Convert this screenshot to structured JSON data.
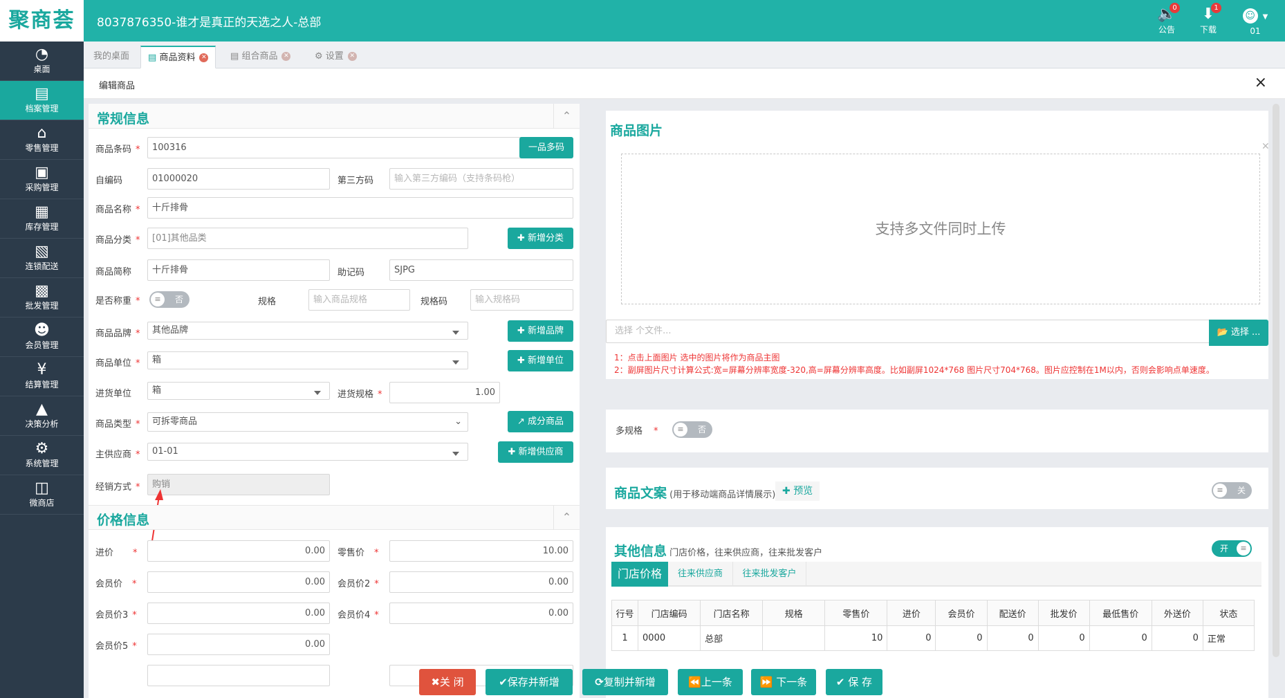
{
  "app": {
    "logo": "聚商荟",
    "title": "8037876350-谁才是真正的天选之人-总部"
  },
  "topbar": {
    "notice": {
      "label": "公告",
      "count": "0"
    },
    "download": {
      "label": "下载",
      "count": "1"
    },
    "user": {
      "label": "01"
    }
  },
  "sidebar": {
    "items": [
      {
        "label": "桌面",
        "icon": "dashboard-icon"
      },
      {
        "label": "档案管理",
        "icon": "file-icon",
        "active": true
      },
      {
        "label": "零售管理",
        "icon": "store-icon"
      },
      {
        "label": "采购管理",
        "icon": "cart-icon"
      },
      {
        "label": "库存管理",
        "icon": "inventory-icon"
      },
      {
        "label": "连锁配送",
        "icon": "truck-icon"
      },
      {
        "label": "批发管理",
        "icon": "wholesale-icon"
      },
      {
        "label": "会员管理",
        "icon": "member-icon"
      },
      {
        "label": "结算管理",
        "icon": "settlement-icon"
      },
      {
        "label": "决策分析",
        "icon": "chart-icon"
      },
      {
        "label": "系统管理",
        "icon": "gear-icon"
      },
      {
        "label": "微商店",
        "icon": "shop-bag-icon"
      }
    ]
  },
  "tabs": [
    {
      "label": "我的桌面"
    },
    {
      "label": "商品资料",
      "active": true
    },
    {
      "label": "组合商品"
    },
    {
      "label": "设置"
    }
  ],
  "page": {
    "title": "编辑商品",
    "close": "×"
  },
  "general": {
    "title": "常规信息",
    "barcode": {
      "label": "商品条码",
      "value": "100316",
      "btn": "一品多码"
    },
    "selfcode": {
      "label": "自编码",
      "value": "01000020"
    },
    "thirdcode": {
      "label": "第三方码",
      "placeholder": "输入第三方编码（支持条码枪）"
    },
    "name": {
      "label": "商品名称",
      "value": "十斤排骨"
    },
    "category": {
      "label": "商品分类",
      "value": "[01]其他品类",
      "btn": "新增分类"
    },
    "shortname": {
      "label": "商品简称",
      "value": "十斤排骨"
    },
    "mnemonic": {
      "label": "助记码",
      "value": "SJPG"
    },
    "weighing": {
      "label": "是否称重",
      "toggle": "否"
    },
    "spec": {
      "label": "规格",
      "placeholder": "输入商品规格"
    },
    "speccode": {
      "label": "规格码",
      "placeholder": "输入规格码"
    },
    "brand": {
      "label": "商品品牌",
      "value": "其他品牌",
      "btn": "新增品牌"
    },
    "unit": {
      "label": "商品单位",
      "value": "箱",
      "btn": "新增单位"
    },
    "purchase_unit": {
      "label": "进货单位",
      "value": "箱"
    },
    "purchase_spec": {
      "label": "进货规格",
      "value": "1.00"
    },
    "type": {
      "label": "商品类型",
      "value": "可拆零商品",
      "btn": "成分商品"
    },
    "supplier": {
      "label": "主供应商",
      "value": "01-01",
      "btn": "新增供应商"
    },
    "mode": {
      "label": "经销方式",
      "value": "购销"
    }
  },
  "price": {
    "title": "价格信息",
    "cost": {
      "label": "进价",
      "value": "0.00"
    },
    "retail": {
      "label": "零售价",
      "value": "10.00"
    },
    "member": {
      "label": "会员价",
      "value": "0.00"
    },
    "member2": {
      "label": "会员价2",
      "value": "0.00"
    },
    "member3": {
      "label": "会员价3",
      "value": "0.00"
    },
    "member4": {
      "label": "会员价4",
      "value": "0.00"
    },
    "member5": {
      "label": "会员价5",
      "value": "0.00"
    }
  },
  "images": {
    "title": "商品图片",
    "drop_text": "支持多文件同时上传",
    "file_placeholder": "选择 个文件...",
    "choose_btn": "选择 ...",
    "note1": "1：点击上面图片 选中的图片将作为商品主图",
    "note2": "2：副屏图片尺寸计算公式:宽=屏幕分辨率宽度-320,高=屏幕分辨率高度。比如副屏1024*768 图片尺寸704*768。图片应控制在1M以内，否则会影响点单速度。"
  },
  "multispec": {
    "label": "多规格",
    "toggle": "否"
  },
  "copy": {
    "title": "商品文案",
    "sub": "(用于移动端商品详情展示)",
    "preview": "预览",
    "toggle": "关"
  },
  "other": {
    "title": "其他信息",
    "sub": "门店价格，往来供应商，往来批发客户",
    "toggle": "开",
    "tabs": [
      "门店价格",
      "往来供应商",
      "往来批发客户"
    ],
    "columns": [
      "行号",
      "门店编码",
      "门店名称",
      "规格",
      "零售价",
      "进价",
      "会员价",
      "配送价",
      "批发价",
      "最低售价",
      "外送价",
      "状态"
    ],
    "rows": [
      [
        "1",
        "0000",
        "总部",
        "",
        "10",
        "0",
        "0",
        "0",
        "0",
        "0",
        "0",
        "正常"
      ]
    ]
  },
  "footer": {
    "close": "关 闭",
    "save_new": "保存并新增",
    "copy_new": "复制并新增",
    "prev": "上一条",
    "next": "下一条",
    "save": "保 存"
  },
  "colors": {
    "primary": "#1aa89e",
    "header": "#21b2a8",
    "sidebar": "#2c3b4a",
    "danger": "#e0533d"
  }
}
